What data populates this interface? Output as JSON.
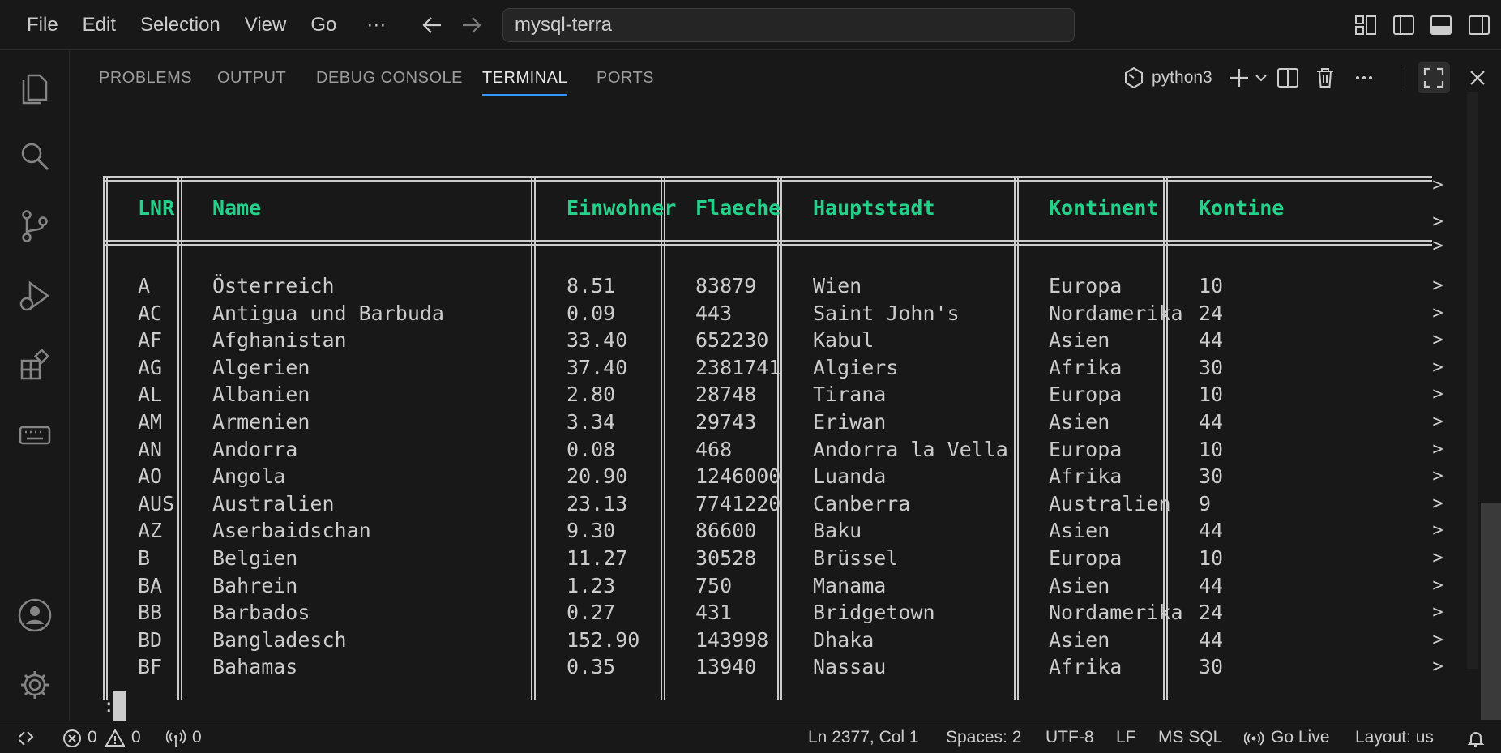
{
  "menu": [
    "File",
    "Edit",
    "Selection",
    "View",
    "Go",
    "···"
  ],
  "command_center": {
    "text": "mysql-terra"
  },
  "panel": {
    "tabs": [
      "PROBLEMS",
      "OUTPUT",
      "DEBUG CONSOLE",
      "TERMINAL",
      "PORTS"
    ],
    "active_tab": "TERMINAL",
    "terminal_name": "python3"
  },
  "terminal": {
    "headers": [
      "LNR",
      "Name",
      "Einwohner",
      "Flaeche",
      "Hauptstadt",
      "Kontinent",
      "Kontine"
    ],
    "more_marker": ">",
    "rows": [
      [
        "A",
        "Österreich",
        "8.51",
        "83879",
        "Wien",
        "Europa",
        "10"
      ],
      [
        "AC",
        "Antigua und Barbuda",
        "0.09",
        "443",
        "Saint John's",
        "Nordamerika",
        "24"
      ],
      [
        "AF",
        "Afghanistan",
        "33.40",
        "652230",
        "Kabul",
        "Asien",
        "44"
      ],
      [
        "AG",
        "Algerien",
        "37.40",
        "2381741",
        "Algiers",
        "Afrika",
        "30"
      ],
      [
        "AL",
        "Albanien",
        "2.80",
        "28748",
        "Tirana",
        "Europa",
        "10"
      ],
      [
        "AM",
        "Armenien",
        "3.34",
        "29743",
        "Eriwan",
        "Asien",
        "44"
      ],
      [
        "AN",
        "Andorra",
        "0.08",
        "468",
        "Andorra la Vella",
        "Europa",
        "10"
      ],
      [
        "AO",
        "Angola",
        "20.90",
        "1246000",
        "Luanda",
        "Afrika",
        "30"
      ],
      [
        "AUS",
        "Australien",
        "23.13",
        "7741220",
        "Canberra",
        "Australien",
        "9"
      ],
      [
        "AZ",
        "Aserbaidschan",
        "9.30",
        "86600",
        "Baku",
        "Asien",
        "44"
      ],
      [
        "B",
        "Belgien",
        "11.27",
        "30528",
        "Brüssel",
        "Europa",
        "10"
      ],
      [
        "BA",
        "Bahrein",
        "1.23",
        "750",
        "Manama",
        "Asien",
        "44"
      ],
      [
        "BB",
        "Barbados",
        "0.27",
        "431",
        "Bridgetown",
        "Nordamerika",
        "24"
      ],
      [
        "BD",
        "Bangladesch",
        "152.90",
        "143998",
        "Dhaka",
        "Asien",
        "44"
      ],
      [
        "BF",
        "Bahamas",
        "0.35",
        "13940",
        "Nassau",
        "Afrika",
        "30"
      ]
    ],
    "prompt": ":"
  },
  "status": {
    "errors": "0",
    "warnings": "0",
    "ports": "0",
    "position": "Ln 2377, Col 1",
    "spaces": "Spaces: 2",
    "encoding": "UTF-8",
    "eol": "LF",
    "language": "MS SQL",
    "go_live": "Go Live",
    "layout": "Layout: us"
  },
  "colors": {
    "accent": "#3794ff",
    "header_green": "#23d18b",
    "background": "#181818"
  }
}
